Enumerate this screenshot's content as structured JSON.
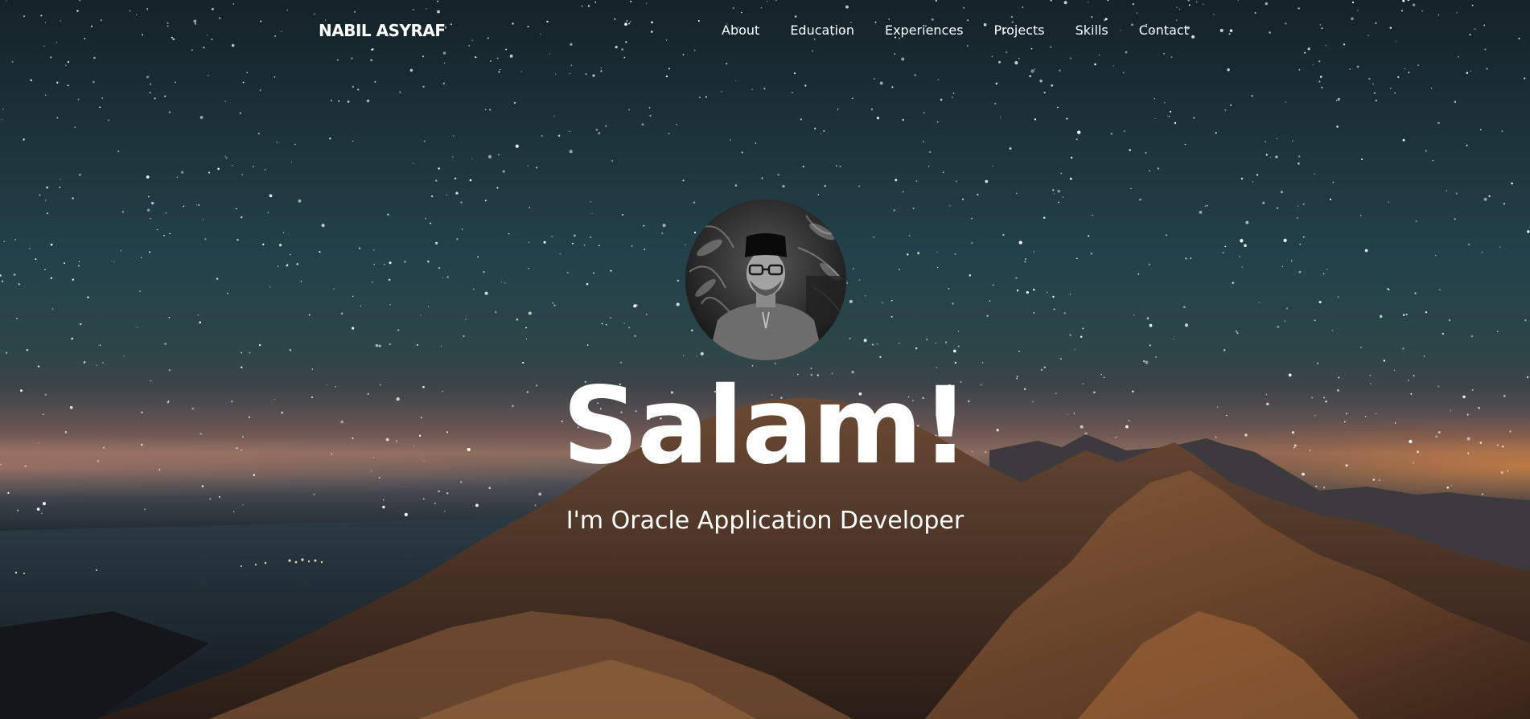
{
  "brand": "NABIL ASYRAF",
  "nav": {
    "items": [
      {
        "label": "About"
      },
      {
        "label": "Education"
      },
      {
        "label": "Experiences"
      },
      {
        "label": "Projects"
      },
      {
        "label": "Skills"
      },
      {
        "label": "Contact"
      }
    ]
  },
  "hero": {
    "headline": "Salam!",
    "subtitle": "I'm Oracle Application Developer",
    "avatar_icon": "profile-photo"
  },
  "colors": {
    "text": "#ffffff",
    "sky": "#1c3239",
    "horizon_glow": "#d6823c",
    "mountain": "#5a3a26"
  }
}
